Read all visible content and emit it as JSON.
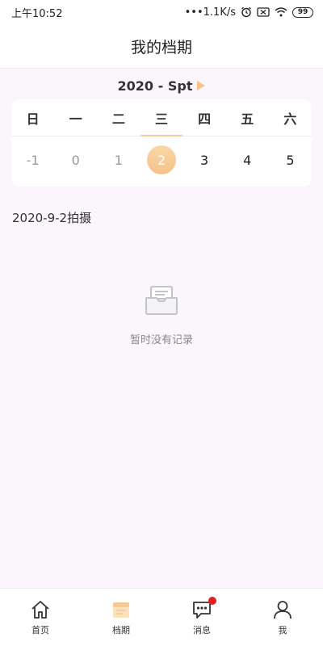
{
  "status_bar": {
    "time": "上午10:52",
    "network_speed": "•••1.1K/s",
    "battery": "99",
    "icons": [
      "alarm-icon",
      "sim-off-icon",
      "wifi-icon",
      "battery-icon"
    ]
  },
  "header": {
    "title": "我的档期"
  },
  "calendar": {
    "month_label": "2020 - Spt",
    "arrow_color": "#f6c38f",
    "weekdays": [
      "日",
      "一",
      "二",
      "三",
      "四",
      "五",
      "六"
    ],
    "active_weekday": "三",
    "dates": [
      "-1",
      "0",
      "1",
      "2",
      "3",
      "4",
      "5"
    ],
    "selected_date": "2",
    "accent_color": "#f5c08a"
  },
  "section": {
    "label": "2020-9-2拍摄"
  },
  "empty_state": {
    "icon": "inbox-icon",
    "text": "暂时没有记录"
  },
  "bottom_nav": {
    "items": [
      {
        "label": "首页",
        "icon": "home-icon"
      },
      {
        "label": "档期",
        "icon": "calendar-icon",
        "active": true
      },
      {
        "label": "消息",
        "icon": "message-icon",
        "badge": true
      },
      {
        "label": "我",
        "icon": "user-icon"
      }
    ]
  }
}
